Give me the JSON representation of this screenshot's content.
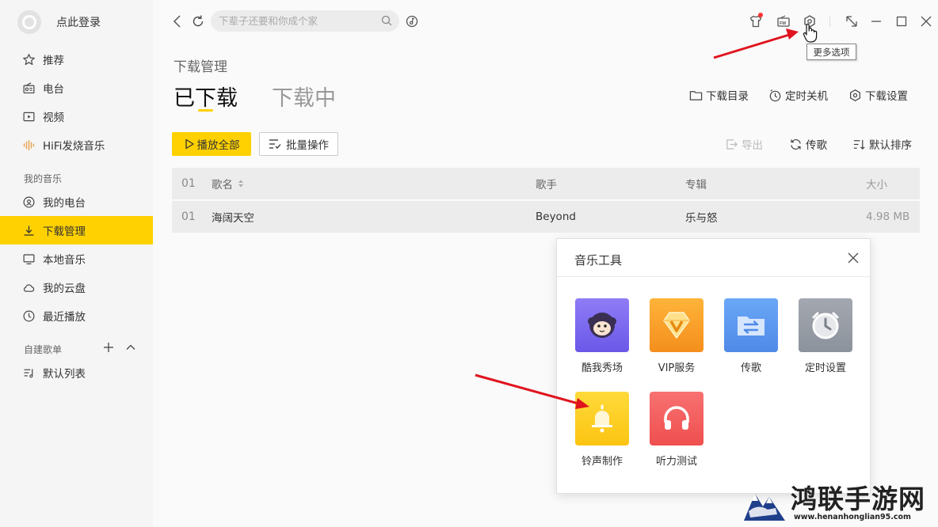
{
  "sidebar": {
    "login_text": "点此登录",
    "items": [
      {
        "label": "推荐",
        "icon": "star-icon"
      },
      {
        "label": "电台",
        "icon": "radio-icon"
      },
      {
        "label": "视频",
        "icon": "video-icon"
      },
      {
        "label": "HiFi发烧音乐",
        "icon": "hifi-icon"
      }
    ],
    "my_music_title": "我的音乐",
    "my_music_items": [
      {
        "label": "我的电台",
        "icon": "my-radio-icon"
      },
      {
        "label": "下载管理",
        "icon": "download-icon",
        "active": true
      },
      {
        "label": "本地音乐",
        "icon": "monitor-icon"
      },
      {
        "label": "我的云盘",
        "icon": "cloud-icon"
      },
      {
        "label": "最近播放",
        "icon": "clock-icon"
      }
    ],
    "playlist_title": "自建歌单",
    "playlist_items": [
      {
        "label": "默认列表",
        "icon": "playlist-icon"
      }
    ]
  },
  "topbar": {
    "search_placeholder": "下辈子还要和你成个家",
    "tooltip": "更多选项"
  },
  "page": {
    "title": "下载管理",
    "tabs": [
      "已下载",
      "下载中"
    ],
    "actions": [
      "下载目录",
      "定时关机",
      "下载设置"
    ],
    "play_all": "播放全部",
    "batch": "批量操作",
    "export": "导出",
    "transfer": "传歌",
    "sort": "默认排序"
  },
  "table": {
    "headers": {
      "num": "01",
      "name": "歌名",
      "artist": "歌手",
      "album": "专辑",
      "size": "大小"
    },
    "rows": [
      {
        "num": "01",
        "name": "海阔天空",
        "artist": "Beyond",
        "album": "乐与怒",
        "size": "4.98 MB"
      }
    ]
  },
  "dialog": {
    "title": "音乐工具",
    "tools": [
      {
        "label": "酷我秀场",
        "icon": "kuwo-show-icon",
        "color": "#7b6af0"
      },
      {
        "label": "VIP服务",
        "icon": "vip-diamond-icon",
        "color": "#fba22a"
      },
      {
        "label": "传歌",
        "icon": "transfer-folder-icon",
        "color": "#5d9af2"
      },
      {
        "label": "定时设置",
        "icon": "timer-icon",
        "color": "#9aa0a8"
      },
      {
        "label": "铃声制作",
        "icon": "bell-icon",
        "color": "#ffd31c"
      },
      {
        "label": "听力测试",
        "icon": "headphones-icon",
        "color": "#f25d5d"
      }
    ]
  },
  "watermark": {
    "main": "鸿联手游网",
    "url": "www.henanhonglian95.com"
  },
  "colors": {
    "accent": "#ffd100",
    "arrow": "#e0141e"
  }
}
